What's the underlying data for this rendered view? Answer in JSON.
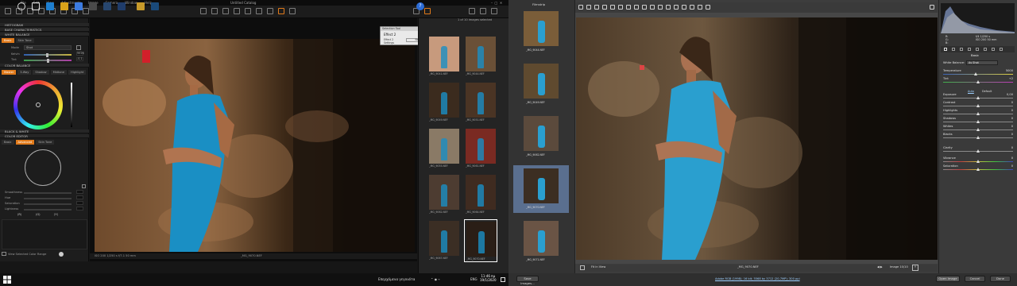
{
  "capture_one": {
    "menu": [
      "File",
      "Edit",
      "View",
      "Adjustments",
      "Image",
      "Camera",
      "Window",
      "Help"
    ],
    "title": "Untitled Catalog",
    "tools_panel": {
      "sections": [
        "HISTOGRAM",
        "BASE CHARACTERISTICS",
        "WHITE BALANCE"
      ],
      "wb_tabs": [
        "Basic",
        "Skin Tone"
      ],
      "wb_mode_label": "Mode",
      "wb_mode_value": "Shot",
      "kelvin_label": "Kelvin",
      "kelvin_value": "5026",
      "tint_label": "Tint",
      "tint_value": "-0,1",
      "color_balance_title": "COLOR BALANCE",
      "color_balance_tabs": [
        "Master",
        "3-Way",
        "Shadow",
        "Midtone",
        "Highlight"
      ],
      "bw_title": "BLACK & WHITE",
      "color_editor_title": "COLOR EDITOR",
      "color_editor_tabs": [
        "Basic",
        "Advanced",
        "Skin Tone"
      ],
      "adv_labels": [
        "Smoothness",
        "Hue",
        "Saturation",
        "Lightness"
      ],
      "adv_buttons": [
        "(R)",
        "(G)",
        "(Y)"
      ],
      "view_selected_label": "View Selected Color Range"
    },
    "viewer_status": "ISO 200 1/250 s f/7.1 50 mm",
    "viewer_filename": "_MG_9070.NEF",
    "floating_palette": {
      "title": "Selection Tool",
      "label": "Effect 2",
      "row1": "Effect 2",
      "row2": "Settings",
      "side": "New"
    },
    "browser": {
      "header": "1 of 10 images selected",
      "thumbs": [
        {
          "name": "_MG_9041.NEF",
          "tone": "#c79a7d"
        },
        {
          "name": "_MG_9044.NEF",
          "tone": "#6a5037"
        },
        {
          "name": "_MG_9049.NEF",
          "tone": "#3b2b1e"
        },
        {
          "name": "_MG_9051.NEF",
          "tone": "#4a3424"
        },
        {
          "name": "_MG_9055.NEF",
          "tone": "#8a7a66"
        },
        {
          "name": "_MG_9061.NEF",
          "tone": "#7a2a22"
        },
        {
          "name": "_MG_9062.NEF",
          "tone": "#4d3c31"
        },
        {
          "name": "_MG_9064.NEF",
          "tone": "#3f2b20"
        },
        {
          "name": "_MG_9067.NEF",
          "tone": "#3b2e24"
        },
        {
          "name": "_MG_9070.NEF",
          "tone": "#2a1e16"
        }
      ]
    }
  },
  "camera_raw": {
    "filmstrip_title": "Filmstrip",
    "filmstrip": [
      {
        "name": "_MG_9044.NEF",
        "tone": "#7a5d39"
      },
      {
        "name": "_MG_9049.NEF",
        "tone": "#5f4a2f"
      },
      {
        "name": "_MG_9062.NEF",
        "tone": "#5b4a3c"
      },
      {
        "name": "_MG_9070.NEF",
        "tone": "#3c2e22",
        "selected": true
      },
      {
        "name": "_MG_9071.NEF",
        "tone": "#6a5445"
      }
    ],
    "histogram_readout": {
      "r_label": "R:",
      "g_label": "G:",
      "b_label": "B:",
      "exposure": "f/4 1/250 s",
      "iso": "ISO 200 50 mm"
    },
    "panel_title": "Basic",
    "white_balance_label": "White Balance:",
    "white_balance_value": "As Shot",
    "sliders": [
      {
        "name": "Temperature",
        "value": "5000",
        "pos": 0.47,
        "track": "temp"
      },
      {
        "name": "Tint",
        "value": "+2",
        "pos": 0.5,
        "track": "tint"
      },
      {
        "name": "Exposure",
        "value": "0,00",
        "pos": 0.5,
        "track": "gray"
      },
      {
        "name": "Contrast",
        "value": "0",
        "pos": 0.5,
        "track": "gray"
      },
      {
        "name": "Highlights",
        "value": "0",
        "pos": 0.5,
        "track": "gray"
      },
      {
        "name": "Shadows",
        "value": "0",
        "pos": 0.5,
        "track": "gray"
      },
      {
        "name": "Whites",
        "value": "0",
        "pos": 0.5,
        "track": "gray"
      },
      {
        "name": "Blacks",
        "value": "0",
        "pos": 0.5,
        "track": "gray"
      },
      {
        "name": "Clarity",
        "value": "0",
        "pos": 0.5,
        "track": "gray"
      },
      {
        "name": "Vibrance",
        "value": "0",
        "pos": 0.5,
        "track": "sat"
      },
      {
        "name": "Saturation",
        "value": "0",
        "pos": 0.5,
        "track": "sat"
      }
    ],
    "auto_label": "Auto",
    "default_label": "Default",
    "zoom": "Fit in View",
    "preview_filename": "_MG_9070.NEF",
    "image_counter": "Image 10/10",
    "workflow_link": "Adobe RGB (1998); 16 bit; 5568 by 3712 (20,7MP); 300 ppi",
    "save_button": "Save Images...",
    "open_button": "Open Image",
    "cancel_button": "Cancel",
    "done_button": "Done"
  },
  "taskbar": {
    "language": "ENG",
    "weather_text": "Επερχόμενα γεγονότα",
    "time": "11:46 πμ",
    "date": "19/1/2020"
  }
}
